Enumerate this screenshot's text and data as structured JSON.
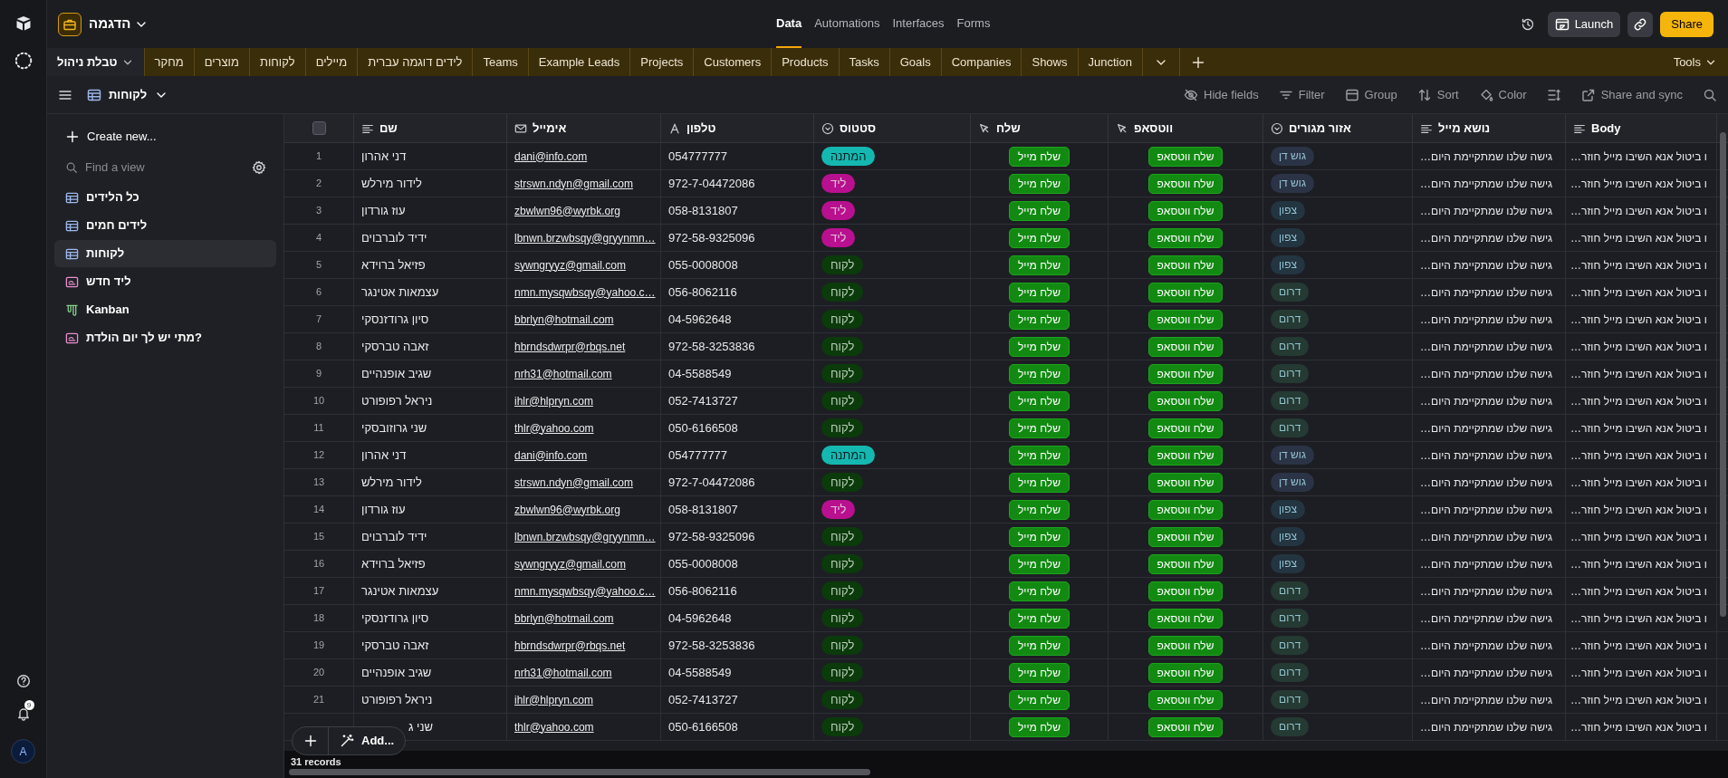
{
  "rail": {
    "notifications": "9",
    "avatar": "A"
  },
  "base": {
    "name": "הדגמה"
  },
  "nav": [
    {
      "label": "Forms",
      "selected": false
    },
    {
      "label": "Interfaces",
      "selected": false
    },
    {
      "label": "Automations",
      "selected": false
    },
    {
      "label": "Data",
      "selected": true
    }
  ],
  "top_actions": {
    "launch": "Launch",
    "share": "Share"
  },
  "tables": [
    {
      "label": "Junction",
      "selected": false
    },
    {
      "label": "Shows",
      "selected": false
    },
    {
      "label": "Companies",
      "selected": false
    },
    {
      "label": "Goals",
      "selected": false
    },
    {
      "label": "Tasks",
      "selected": false
    },
    {
      "label": "Products",
      "selected": false
    },
    {
      "label": "Customers",
      "selected": false
    },
    {
      "label": "Projects",
      "selected": false
    },
    {
      "label": "Example Leads",
      "selected": false
    },
    {
      "label": "Teams",
      "selected": false
    },
    {
      "label": "לידים דוגמה עברית",
      "selected": false
    },
    {
      "label": "מיילים",
      "selected": false
    },
    {
      "label": "לקוחות",
      "selected": false
    },
    {
      "label": "מוצרים",
      "selected": false
    },
    {
      "label": "מחקר",
      "selected": false
    },
    {
      "label": "טבלת ניהול",
      "selected": true
    }
  ],
  "tools": "Tools",
  "view": {
    "name": "לקוחות"
  },
  "toolbar": [
    {
      "kind": "search"
    },
    {
      "kind": "share",
      "label": "Share and sync"
    },
    {
      "kind": "row-height"
    },
    {
      "kind": "color",
      "label": "Color"
    },
    {
      "kind": "sort",
      "label": "Sort"
    },
    {
      "kind": "group",
      "label": "Group"
    },
    {
      "kind": "filter",
      "label": "Filter"
    },
    {
      "kind": "hide",
      "label": "Hide fields"
    }
  ],
  "sidebar": {
    "create": "Create new...",
    "search_placeholder": "Find a view",
    "views": [
      {
        "kind": "grid",
        "label": "כל הלידים",
        "selected": false
      },
      {
        "kind": "grid",
        "label": "לידים חמים",
        "selected": false
      },
      {
        "kind": "grid",
        "label": "לקוחות",
        "selected": true
      },
      {
        "kind": "form",
        "label": "ליד חדש",
        "selected": false
      },
      {
        "kind": "kanban",
        "label": "Kanban",
        "selected": false
      },
      {
        "kind": "form",
        "label": "מתי יש לך יום הולדת?",
        "selected": false
      }
    ]
  },
  "table": {
    "select_all": {
      "checked": false
    },
    "columns": [
      {
        "kind": "text",
        "label": "Body"
      },
      {
        "kind": "text",
        "label": "נושא מייל"
      },
      {
        "kind": "select",
        "label": "אזור מגורים"
      },
      {
        "kind": "button",
        "label": "ווטסאפ"
      },
      {
        "kind": "button",
        "label": "שלח"
      },
      {
        "kind": "select",
        "label": "סטטוס"
      },
      {
        "kind": "phone",
        "label": "טלפון"
      },
      {
        "kind": "email",
        "label": "אימייל"
      },
      {
        "kind": "text",
        "label": "שם"
      },
      {
        "kind": "checkbox"
      }
    ],
    "rows": [
      {
        "num": "1",
        "name": "דני אהרון",
        "email": "dani@info.com",
        "phone": "054777777",
        "status": {
          "label": "המתנה",
          "color": "#14b8b0"
        },
        "send": "שלח מייל",
        "whatsapp": "שלח ווטסאפ",
        "region": {
          "label": "גוש דן",
          "color": "#2b3446"
        },
        "subject": "…גישה שלנו שמתקיימת היום",
        "body": "…ו ביטול אנא השיבו מייל חוזר"
      },
      {
        "num": "2",
        "name": "לידור מירלש",
        "email": "strswn.ndyn@gmail.com",
        "phone": "972-7-04472086",
        "status": {
          "label": "ליד",
          "color": "#b8108f"
        },
        "send": "שלח מייל",
        "whatsapp": "שלח ווטסאפ",
        "region": {
          "label": "גוש דן",
          "color": "#2b3446"
        },
        "subject": "…גישה שלנו שמתקיימת היום",
        "body": "…ו ביטול אנא השיבו מייל חוזר"
      },
      {
        "num": "3",
        "name": "עוז גורדון",
        "email": "zbwlwn96@wyrbk.org",
        "phone": "058-8131807",
        "status": {
          "label": "ליד",
          "color": "#b8108f"
        },
        "send": "שלח מייל",
        "whatsapp": "שלח ווטסאפ",
        "region": {
          "label": "צפון",
          "color": "#233541"
        },
        "subject": "…גישה שלנו שמתקיימת היום",
        "body": "…ו ביטול אנא השיבו מייל חוזר"
      },
      {
        "num": "4",
        "name": "ידיד לוברבוים",
        "email": "lbnwn.brzwbsqy@gryynmn…",
        "phone": "972-58-9325096",
        "status": {
          "label": "ליד",
          "color": "#b8108f"
        },
        "send": "שלח מייל",
        "whatsapp": "שלח ווטסאפ",
        "region": {
          "label": "צפון",
          "color": "#233541"
        },
        "subject": "…גישה שלנו שמתקיימת היום",
        "body": "…ו ביטול אנא השיבו מייל חוזר"
      },
      {
        "num": "5",
        "name": "פזיאל ברוידא",
        "email": "sywngryyz@gmail.com",
        "phone": "055-0008008",
        "status": {
          "label": "לקוח",
          "color": "#0b3a0b"
        },
        "send": "שלח מייל",
        "whatsapp": "שלח ווטסאפ",
        "region": {
          "label": "צפון",
          "color": "#233541"
        },
        "subject": "…גישה שלנו שמתקיימת היום",
        "body": "…ו ביטול אנא השיבו מייל חוזר"
      },
      {
        "num": "6",
        "name": "עצמאות אטינגר",
        "email": "nmn.mysqwbsqy@yahoo.c…",
        "phone": "056-8062116",
        "status": {
          "label": "לקוח",
          "color": "#0b3a0b"
        },
        "send": "שלח מייל",
        "whatsapp": "שלח ווטסאפ",
        "region": {
          "label": "דרום",
          "color": "#243a33"
        },
        "subject": "…גישה שלנו שמתקיימת היום",
        "body": "…ו ביטול אנא השיבו מייל חוזר"
      },
      {
        "num": "7",
        "name": "סיון גרודזנסקי",
        "email": "bbrlyn@hotmail.com",
        "phone": "04-5962648",
        "status": {
          "label": "לקוח",
          "color": "#0b3a0b"
        },
        "send": "שלח מייל",
        "whatsapp": "שלח ווטסאפ",
        "region": {
          "label": "דרום",
          "color": "#243a33"
        },
        "subject": "…גישה שלנו שמתקיימת היום",
        "body": "…ו ביטול אנא השיבו מייל חוזר"
      },
      {
        "num": "8",
        "name": "זאבה טברסקי",
        "email": "hbrndsdwrpr@rbqs.net",
        "phone": "972-58-3253836",
        "status": {
          "label": "לקוח",
          "color": "#0b3a0b"
        },
        "send": "שלח מייל",
        "whatsapp": "שלח ווטסאפ",
        "region": {
          "label": "דרום",
          "color": "#243a33"
        },
        "subject": "…גישה שלנו שמתקיימת היום",
        "body": "…ו ביטול אנא השיבו מייל חוזר"
      },
      {
        "num": "9",
        "name": "שגיב אופנהיים",
        "email": "nrh31@hotmail.com",
        "phone": "04-5588549",
        "status": {
          "label": "לקוח",
          "color": "#0b3a0b"
        },
        "send": "שלח מייל",
        "whatsapp": "שלח ווטסאפ",
        "region": {
          "label": "דרום",
          "color": "#243a33"
        },
        "subject": "…גישה שלנו שמתקיימת היום",
        "body": "…ו ביטול אנא השיבו מייל חוזר"
      },
      {
        "num": "10",
        "name": "ניראל רפופורט",
        "email": "ihlr@hlpryn.com",
        "phone": "052-7413727",
        "status": {
          "label": "לקוח",
          "color": "#0b3a0b"
        },
        "send": "שלח מייל",
        "whatsapp": "שלח ווטסאפ",
        "region": {
          "label": "דרום",
          "color": "#243a33"
        },
        "subject": "…גישה שלנו שמתקיימת היום",
        "body": "…ו ביטול אנא השיבו מייל חוזר"
      },
      {
        "num": "11",
        "name": "שני גרוזובסקי",
        "email": "thlr@yahoo.com",
        "phone": "050-6166508",
        "status": {
          "label": "לקוח",
          "color": "#0b3a0b"
        },
        "send": "שלח מייל",
        "whatsapp": "שלח ווטסאפ",
        "region": {
          "label": "דרום",
          "color": "#243a33"
        },
        "subject": "…גישה שלנו שמתקיימת היום",
        "body": "…ו ביטול אנא השיבו מייל חוזר"
      },
      {
        "num": "12",
        "name": "דני אהרון",
        "email": "dani@info.com",
        "phone": "054777777",
        "status": {
          "label": "המתנה",
          "color": "#14b8b0"
        },
        "send": "שלח מייל",
        "whatsapp": "שלח ווטסאפ",
        "region": {
          "label": "גוש דן",
          "color": "#2b3446"
        },
        "subject": "…גישה שלנו שמתקיימת היום",
        "body": "…ו ביטול אנא השיבו מייל חוזר"
      },
      {
        "num": "13",
        "name": "לידור מירלש",
        "email": "strswn.ndyn@gmail.com",
        "phone": "972-7-04472086",
        "status": {
          "label": "לקוח",
          "color": "#0b3a0b"
        },
        "send": "שלח מייל",
        "whatsapp": "שלח ווטסאפ",
        "region": {
          "label": "גוש דן",
          "color": "#2b3446"
        },
        "subject": "…גישה שלנו שמתקיימת היום",
        "body": "…ו ביטול אנא השיבו מייל חוזר"
      },
      {
        "num": "14",
        "name": "עוז גורדון",
        "email": "zbwlwn96@wyrbk.org",
        "phone": "058-8131807",
        "status": {
          "label": "ליד",
          "color": "#b8108f"
        },
        "send": "שלח מייל",
        "whatsapp": "שלח ווטסאפ",
        "region": {
          "label": "צפון",
          "color": "#233541"
        },
        "subject": "…גישה שלנו שמתקיימת היום",
        "body": "…ו ביטול אנא השיבו מייל חוזר"
      },
      {
        "num": "15",
        "name": "ידיד לוברבוים",
        "email": "lbnwn.brzwbsqy@gryynmn…",
        "phone": "972-58-9325096",
        "status": {
          "label": "לקוח",
          "color": "#0b3a0b"
        },
        "send": "שלח מייל",
        "whatsapp": "שלח ווטסאפ",
        "region": {
          "label": "צפון",
          "color": "#233541"
        },
        "subject": "…גישה שלנו שמתקיימת היום",
        "body": "…ו ביטול אנא השיבו מייל חוזר"
      },
      {
        "num": "16",
        "name": "פזיאל ברוידא",
        "email": "sywngryyz@gmail.com",
        "phone": "055-0008008",
        "status": {
          "label": "לקוח",
          "color": "#0b3a0b"
        },
        "send": "שלח מייל",
        "whatsapp": "שלח ווטסאפ",
        "region": {
          "label": "צפון",
          "color": "#233541"
        },
        "subject": "…גישה שלנו שמתקיימת היום",
        "body": "…ו ביטול אנא השיבו מייל חוזר"
      },
      {
        "num": "17",
        "name": "עצמאות אטינגר",
        "email": "nmn.mysqwbsqy@yahoo.c…",
        "phone": "056-8062116",
        "status": {
          "label": "לקוח",
          "color": "#0b3a0b"
        },
        "send": "שלח מייל",
        "whatsapp": "שלח ווטסאפ",
        "region": {
          "label": "דרום",
          "color": "#243a33"
        },
        "subject": "…גישה שלנו שמתקיימת היום",
        "body": "…ו ביטול אנא השיבו מייל חוזר"
      },
      {
        "num": "18",
        "name": "סיון גרודזנסקי",
        "email": "bbrlyn@hotmail.com",
        "phone": "04-5962648",
        "status": {
          "label": "לקוח",
          "color": "#0b3a0b"
        },
        "send": "שלח מייל",
        "whatsapp": "שלח ווטסאפ",
        "region": {
          "label": "דרום",
          "color": "#243a33"
        },
        "subject": "…גישה שלנו שמתקיימת היום",
        "body": "…ו ביטול אנא השיבו מייל חוזר"
      },
      {
        "num": "19",
        "name": "זאבה טברסקי",
        "email": "hbrndsdwrpr@rbqs.net",
        "phone": "972-58-3253836",
        "status": {
          "label": "לקוח",
          "color": "#0b3a0b"
        },
        "send": "שלח מייל",
        "whatsapp": "שלח ווטסאפ",
        "region": {
          "label": "דרום",
          "color": "#243a33"
        },
        "subject": "…גישה שלנו שמתקיימת היום",
        "body": "…ו ביטול אנא השיבו מייל חוזר"
      },
      {
        "num": "20",
        "name": "שגיב אופנהיים",
        "email": "nrh31@hotmail.com",
        "phone": "04-5588549",
        "status": {
          "label": "לקוח",
          "color": "#0b3a0b"
        },
        "send": "שלח מייל",
        "whatsapp": "שלח ווטסאפ",
        "region": {
          "label": "דרום",
          "color": "#243a33"
        },
        "subject": "…גישה שלנו שמתקיימת היום",
        "body": "…ו ביטול אנא השיבו מייל חוזר"
      },
      {
        "num": "21",
        "name": "ניראל רפופורט",
        "email": "ihlr@hlpryn.com",
        "phone": "052-7413727",
        "status": {
          "label": "לקוח",
          "color": "#0b3a0b"
        },
        "send": "שלח מייל",
        "whatsapp": "שלח ווטסאפ",
        "region": {
          "label": "דרום",
          "color": "#243a33"
        },
        "subject": "…גישה שלנו שמתקיימת היום",
        "body": "…ו ביטול אנא השיבו מייל חוזר"
      },
      {
        "name": "שני ג",
        "email": "thlr@yahoo.com",
        "phone": "050-6166508",
        "status": {
          "label": "לקוח",
          "color": "#0b3a0b"
        },
        "send": "שלח מייל",
        "whatsapp": "שלח ווטסאפ",
        "region": {
          "label": "דרום",
          "color": "#243a33"
        },
        "subject": "…גישה שלנו שמתקיימת היום",
        "body": "…ו ביטול אנא השיבו מייל חוזר"
      }
    ]
  },
  "footer": {
    "records": "31 records"
  },
  "add_menu": {
    "label": "Add..."
  }
}
